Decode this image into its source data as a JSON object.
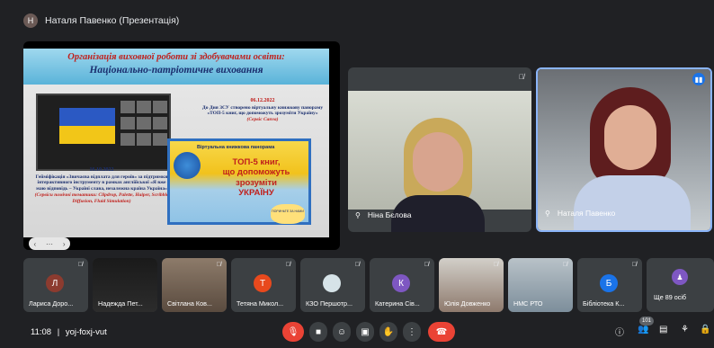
{
  "presenter_bar": {
    "avatar_letter": "Н",
    "title": "Наталя Павенко (Презентація)"
  },
  "slide": {
    "title_line1": "Організація виховної роботи зі здобувачами освіти:",
    "title_line2": "Національно-патріотичне виховання",
    "event1_date": "06.12.2022",
    "event1_text": "До Дня ЗСУ створено віртуальну книжкову панораму «ТОП-5 книг, що допоможуть зрозуміти Україну»",
    "event1_src": "(Сервіс Canva)",
    "event2_date": "16.10.2022",
    "event2_text": "Гейміфікація «Звичаєва відплата для героїв» за підтримки інтерактивного інструменту в рамках англійської «Я вже маю відповідь – Україні слава, незалежна країна Україна»",
    "event2_src": "(Сервіси помічні тематики: Clipdrop, Palette, Haiper, Scribble Diffusion, Fluid Simulation)",
    "poster_title": "Віртуальна книжкова панорама",
    "poster_big_line1": "ТОП-5 книг,",
    "poster_big_line2": "що допоможуть зрозуміти",
    "poster_big_line3": "УКРАЇНУ",
    "poster_badge": "ПОРИНЬТЕ ЗА НАМИ",
    "nav_prev": "‹",
    "nav_dots": "⋯",
    "nav_next": "›"
  },
  "tiles": [
    {
      "name": "Ніна Бєлова"
    },
    {
      "name": "Наталя Павенко"
    }
  ],
  "strip": [
    {
      "letter": "Л",
      "name": "Лариса Доро...",
      "color": "#8c3b2f"
    },
    {
      "letter": "",
      "name": "Надежда Пет...",
      "color": ""
    },
    {
      "letter": "",
      "name": "Світлана Ков...",
      "color": ""
    },
    {
      "letter": "Т",
      "name": "Тетяна Микол...",
      "color": "#e8491d"
    },
    {
      "letter": "",
      "name": "КЗО Першотр...",
      "color": ""
    },
    {
      "letter": "К",
      "name": "Катерина Сів...",
      "color": "#7e57c2"
    },
    {
      "letter": "",
      "name": "Юлія Довженко",
      "color": ""
    },
    {
      "letter": "",
      "name": "НМС РТО",
      "color": ""
    },
    {
      "letter": "Б",
      "name": "Бібліотека К...",
      "color": "#1a73e8"
    },
    {
      "letter": "",
      "name": "Ще 89 осіб",
      "color": ""
    }
  ],
  "bottom": {
    "time": "11:08",
    "separator": "|",
    "meeting_code": "yoj-foxj-vut",
    "participants_count": "101"
  },
  "icons": {
    "mic_off": "mic-off-icon",
    "pin": "pin-icon",
    "speaking": "speaking-icon"
  }
}
